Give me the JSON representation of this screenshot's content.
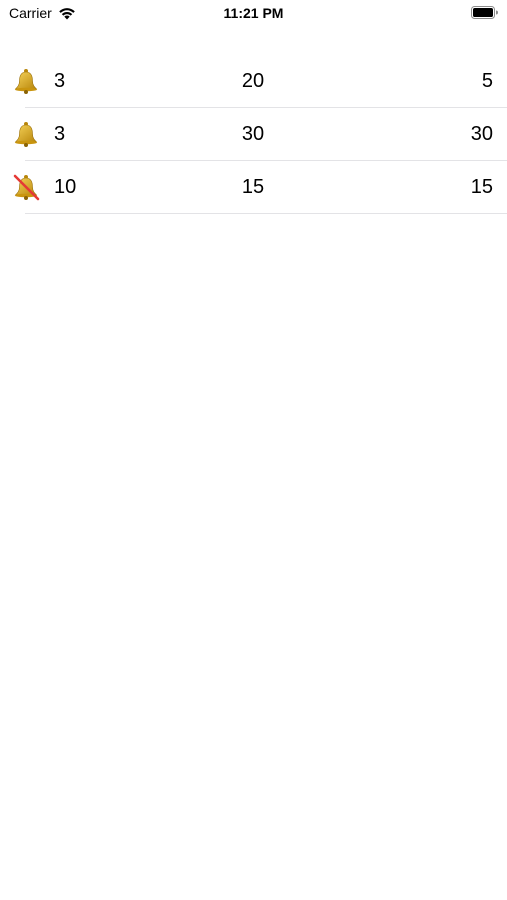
{
  "status_bar": {
    "carrier": "Carrier",
    "time": "11:21 PM",
    "wifi_icon": "wifi-icon",
    "battery_icon": "battery-icon"
  },
  "rows": [
    {
      "bell": "bell-icon",
      "muted": false,
      "col1": "3",
      "col2": "20",
      "col3": "5"
    },
    {
      "bell": "bell-icon",
      "muted": false,
      "col1": "3",
      "col2": "30",
      "col3": "30"
    },
    {
      "bell": "bell-muted-icon",
      "muted": true,
      "col1": "10",
      "col2": "15",
      "col3": "15"
    }
  ],
  "colors": {
    "bell_gold": "#d9a21b",
    "mute_slash": "#e53935",
    "separator": "#e3e3e6"
  }
}
